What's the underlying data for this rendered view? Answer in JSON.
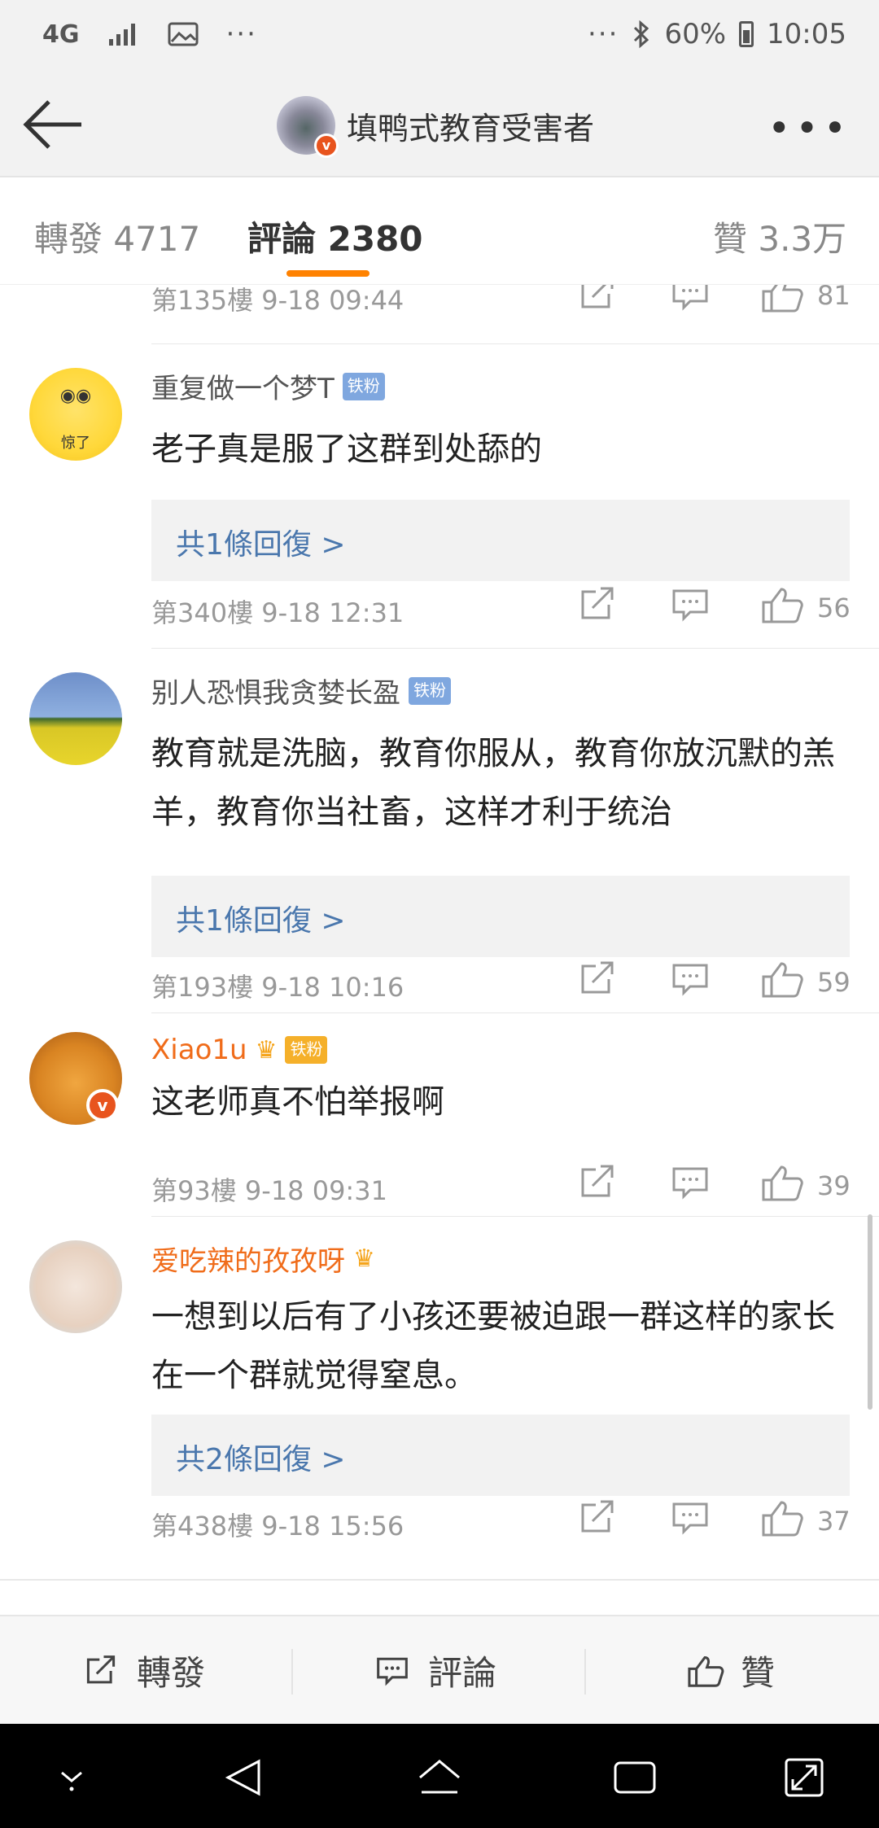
{
  "status_bar": {
    "network": "4G",
    "time": "10:05",
    "battery": "60%",
    "more": "···"
  },
  "header": {
    "title": "填鸭式教育受害者",
    "more": "•••"
  },
  "tabs": [
    {
      "label": "轉發 4717"
    },
    {
      "label": "評論 2380"
    },
    {
      "label": "贊 3.3万"
    }
  ],
  "comments": [
    {
      "floor": "第135樓",
      "time": "9-18 09:44",
      "likes": "81"
    },
    {
      "name": "重复做一个梦T",
      "fan_badge": "铁粉",
      "avatar_label": "惊了",
      "text": "老子真是服了这群到处舔的",
      "replies": "共1條回復 >",
      "floor": "第340樓",
      "time": "9-18 12:31",
      "likes": "56"
    },
    {
      "name": "别人恐惧我贪婪长盈",
      "fan_badge": "铁粉",
      "text": "教育就是洗脑，教育你服从，教育你放沉默的羔羊，教育你当社畜，这样才利于统治",
      "replies": "共1條回復 >",
      "floor": "第193樓",
      "time": "9-18 10:16",
      "likes": "59"
    },
    {
      "name": "Xiao1u",
      "fan_badge": "铁粉",
      "text": "这老师真不怕举报啊",
      "floor": "第93樓",
      "time": "9-18 09:31",
      "likes": "39"
    },
    {
      "name": "爱吃辣的孜孜呀",
      "text": "一想到以后有了小孩还要被迫跟一群这样的家长在一个群就觉得窒息。",
      "replies": "共2條回復 >",
      "floor": "第438樓",
      "time": "9-18 15:56",
      "likes": "37"
    }
  ],
  "bottom_bar": {
    "repost": "轉發",
    "comment": "評論",
    "like": "贊"
  },
  "colors": {
    "accent": "#ff8200",
    "link": "#4a77ad",
    "vip_name": "#f06c1a"
  }
}
